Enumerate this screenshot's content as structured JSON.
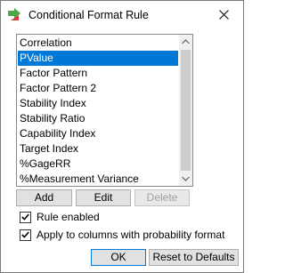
{
  "window": {
    "title": "Conditional Format Rule"
  },
  "rules_list": {
    "items": [
      "Correlation",
      "PValue",
      "Factor Pattern",
      "Factor Pattern 2",
      "Stability Index",
      "Stability Ratio",
      "Capability Index",
      "Target Index",
      "%GageRR",
      "%Measurement Variance"
    ],
    "selected": "PValue"
  },
  "buttons": {
    "add": "Add",
    "edit": "Edit",
    "delete": "Delete",
    "ok": "OK",
    "reset": "Reset to Defaults"
  },
  "options": {
    "rule_enabled": {
      "label": "Rule enabled",
      "checked": true
    },
    "apply_probability": {
      "label": "Apply to columns with probability format",
      "checked": true
    }
  },
  "colors": {
    "selection": "#0078d7",
    "icon_green": "#4aa84a",
    "icon_red": "#d83b3b"
  }
}
